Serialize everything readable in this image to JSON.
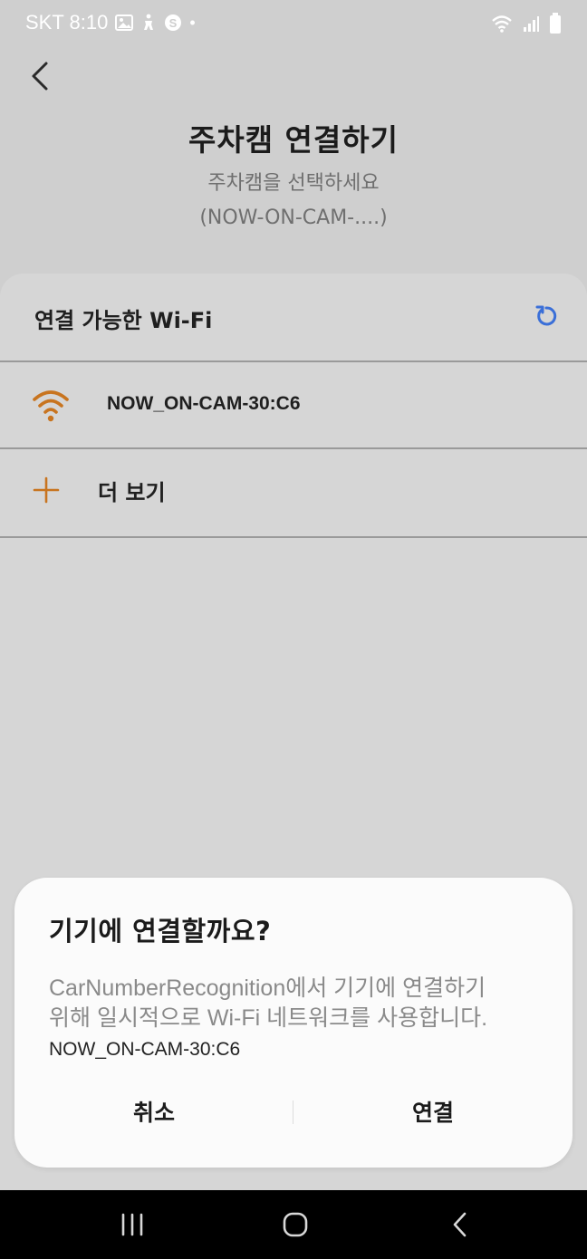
{
  "status_bar": {
    "carrier_time": "SKT 8:10",
    "dot": "•",
    "icons": [
      "gallery-icon",
      "accessibility-icon",
      "s-badge-icon",
      "wifi-status-icon",
      "signal-icon",
      "battery-icon"
    ]
  },
  "header": {
    "title": "주차캠 연결하기",
    "subtitle_line1": "주차캠을 선택하세요",
    "subtitle_line2": "(NOW-ON-CAM-....)"
  },
  "wifi_list": {
    "section_title": "연결 가능한 Wi-Fi",
    "networks": [
      {
        "ssid": "NOW_ON-CAM-30:C6",
        "icon": "wifi-icon"
      }
    ],
    "more_label": "더 보기"
  },
  "dialog": {
    "title": "기기에 연결할까요?",
    "body_line1": "CarNumberRecognition에서 기기에 연결하기",
    "body_line2": "위해 일시적으로 Wi-Fi 네트워크를 사용합니다.",
    "ssid": "NOW_ON-CAM-30:C6",
    "cancel_label": "취소",
    "connect_label": "연결"
  },
  "colors": {
    "accent_orange": "#c8741f",
    "refresh_blue": "#3a6fd8",
    "background": "#cfcfcf",
    "dialog_bg": "#fbfbfb",
    "nav_bg": "#000000"
  }
}
